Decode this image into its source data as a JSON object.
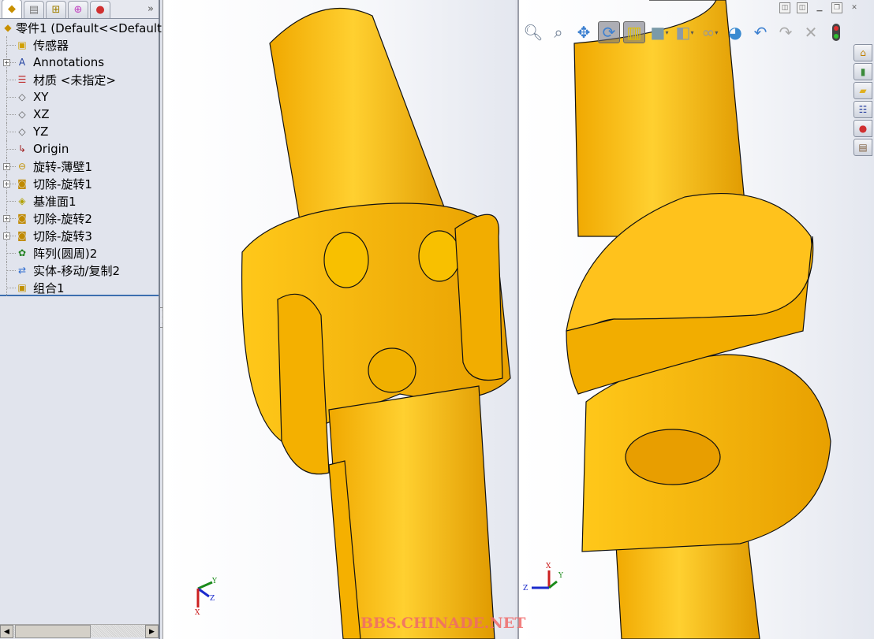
{
  "sidebar": {
    "tabs": [
      {
        "icon": "feature-manager-icon"
      },
      {
        "icon": "property-manager-icon"
      },
      {
        "icon": "configuration-manager-icon"
      },
      {
        "icon": "dimxpert-icon"
      },
      {
        "icon": "display-manager-icon"
      }
    ],
    "more": "»",
    "tree": [
      {
        "label": "零件1  (Default<<Default",
        "icon": "part-icon",
        "expandable": false,
        "root": true
      },
      {
        "label": "传感器",
        "icon": "sensors-folder-icon",
        "expandable": false
      },
      {
        "label": "Annotations",
        "icon": "annotations-icon",
        "expandable": true
      },
      {
        "label": "材质 <未指定>",
        "icon": "material-icon",
        "expandable": false
      },
      {
        "label": "XY",
        "icon": "plane-icon",
        "expandable": false
      },
      {
        "label": "XZ",
        "icon": "plane-icon",
        "expandable": false
      },
      {
        "label": "YZ",
        "icon": "plane-icon",
        "expandable": false
      },
      {
        "label": "Origin",
        "icon": "origin-icon",
        "expandable": false
      },
      {
        "label": "旋转-薄壁1",
        "icon": "revolve-thin-icon",
        "expandable": true
      },
      {
        "label": "切除-旋转1",
        "icon": "cut-revolve-icon",
        "expandable": true
      },
      {
        "label": "基准面1",
        "icon": "ref-plane-icon",
        "expandable": false
      },
      {
        "label": "切除-旋转2",
        "icon": "cut-revolve-icon",
        "expandable": true
      },
      {
        "label": "切除-旋转3",
        "icon": "cut-revolve-icon",
        "expandable": true
      },
      {
        "label": "阵列(圆周)2",
        "icon": "circular-pattern-icon",
        "expandable": false
      },
      {
        "label": "实体-移动/复制2",
        "icon": "move-copy-body-icon",
        "expandable": false
      },
      {
        "label": "组合1",
        "icon": "combine-icon",
        "expandable": false
      }
    ]
  },
  "toolbar": [
    "zoom-to-fit-icon",
    "zoom-to-area-icon",
    "pan-icon",
    "rotate-icon",
    "section-view-icon",
    "view-orientation-icon",
    "display-style-icon",
    "hide-show-icon",
    "appearance-icon",
    "undo-icon",
    "redo-icon",
    "cancel-icon",
    "traffic-light-icon"
  ],
  "triad_left": {
    "x": "X",
    "y": "Y",
    "z": "Z"
  },
  "triad_right": {
    "x": "X",
    "y": "Y",
    "z": "Z"
  },
  "watermark": "BBS.CHINADE.NET",
  "colors": {
    "model": "#f7b80f",
    "model_dark": "#c98a00",
    "watermark": "#f06a6a"
  }
}
